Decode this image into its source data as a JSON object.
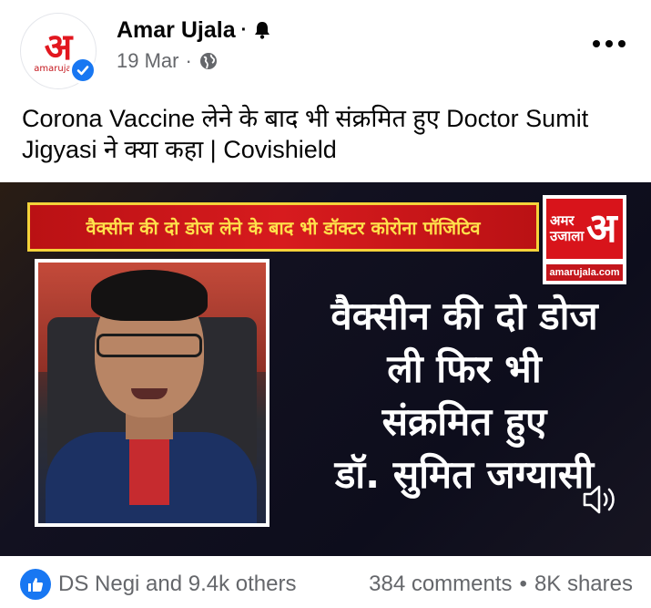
{
  "post": {
    "page_name": "Amar Ujala",
    "separator": "·",
    "date": "19 Mar",
    "text": "Corona Vaccine लेने के बाद भी संक्रमित हुए Doctor Sumit Jigyasi ने क्या कहा | Covishield",
    "avatar_mark": "अ",
    "avatar_brand": "amarujala."
  },
  "video": {
    "banner_text": "वैक्सीन की दो डोज लेने के बाद भी डॉक्टर कोरोना पॉजिटिव",
    "logo_text": "अमर उजाला",
    "logo_glyph": "अ",
    "logo_url": "amarujala.com",
    "overlay_lines": [
      "वैक्सीन की दो डोज",
      "ली फिर भी",
      "संक्रमित हुए",
      "डॉ. सुमित जग्यासी"
    ]
  },
  "engagement": {
    "reactors": "DS Negi and 9.4k others",
    "comments": "384 comments",
    "dot": "•",
    "shares": "8K shares"
  },
  "colors": {
    "facebook_blue": "#1877f2",
    "brand_red": "#d8141b",
    "banner_yellow": "#ffe14b",
    "secondary_text": "#65676b"
  },
  "icons": [
    "verified-badge-icon",
    "bell-icon",
    "globe-icon",
    "more-options-icon",
    "sound-icon",
    "like-icon"
  ]
}
